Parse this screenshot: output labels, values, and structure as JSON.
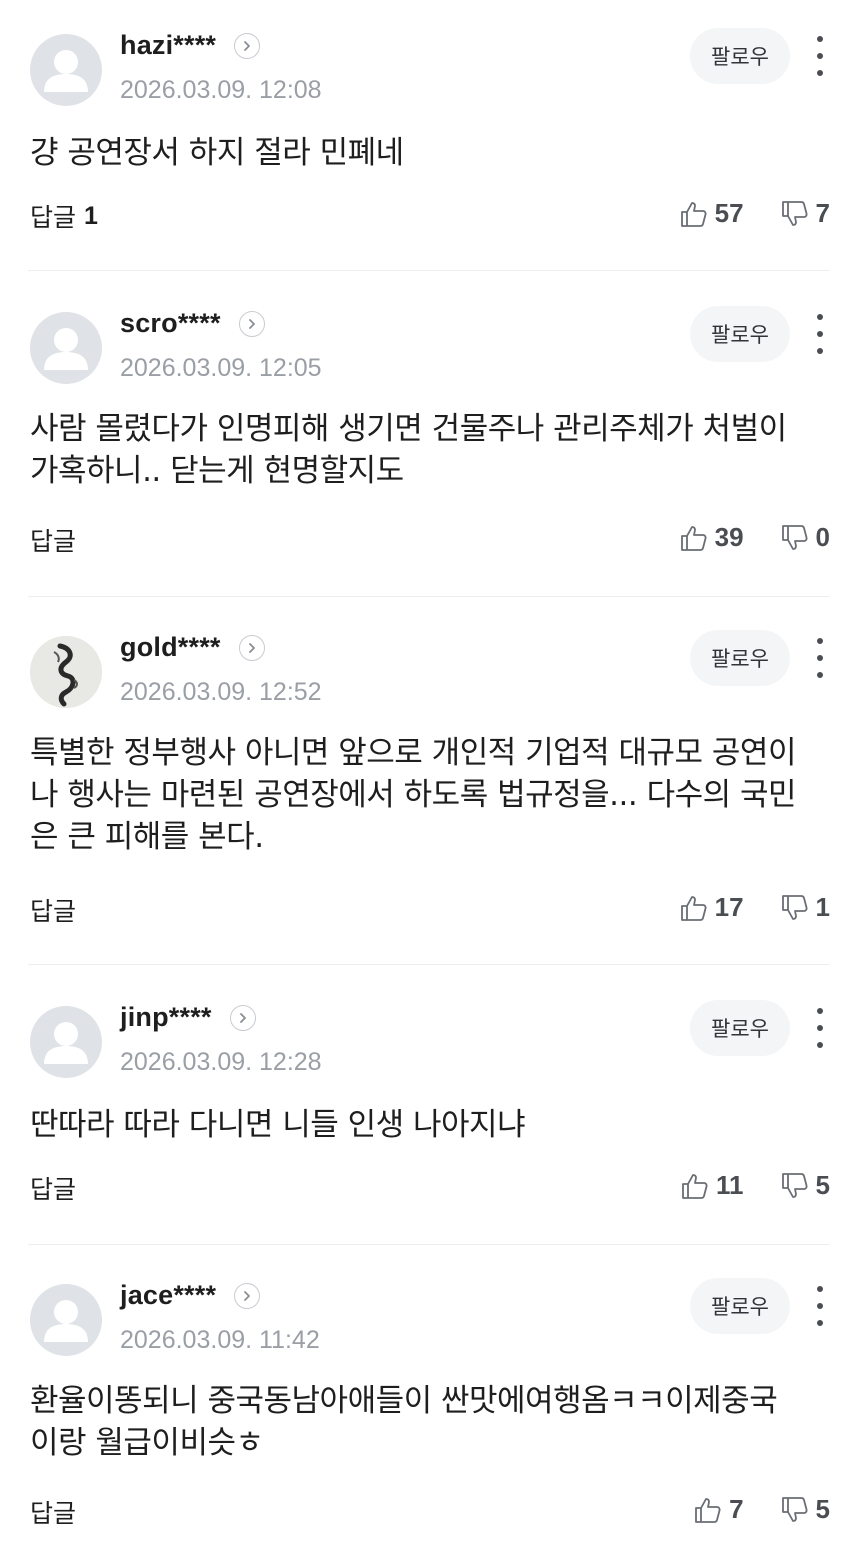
{
  "follow_label": "팔로우",
  "reply_label": "답글",
  "comments": [
    {
      "username": "hazi****",
      "timestamp": "2026.03.09. 12:08",
      "text": "걍 공연장서 하지 절라 민폐네",
      "reply_count": "1",
      "likes": "57",
      "dislikes": "7",
      "avatar": "default-avatar"
    },
    {
      "username": "scro****",
      "timestamp": "2026.03.09. 12:05",
      "text": "사람 몰렸다가 인명피해 생기면 건물주나 관리주체가 처벌이 가혹하니.. 닫는게 현명할지도",
      "reply_count": "",
      "likes": "39",
      "dislikes": "0",
      "avatar": "default-avatar"
    },
    {
      "username": "gold****",
      "timestamp": "2026.03.09. 12:52",
      "text": "특별한 정부행사 아니면 앞으로 개인적 기업적 대규모 공연이나 행사는 마련된 공연장에서 하도록 법규정을... 다수의 국민은 큰 피해를 본다.",
      "reply_count": "",
      "likes": "17",
      "dislikes": "1",
      "avatar": "custom-photo-avatar"
    },
    {
      "username": "jinp****",
      "timestamp": "2026.03.09. 12:28",
      "text": "딴따라 따라 다니면 니들 인생 나아지냐",
      "reply_count": "",
      "likes": "11",
      "dislikes": "5",
      "avatar": "default-avatar"
    },
    {
      "username": "jace****",
      "timestamp": "2026.03.09. 11:42",
      "text": "환율이똥되니 중국동남아애들이 싼맛에여행옴ㅋㅋ이제중국이랑 월급이비슷ㅎ",
      "reply_count": "",
      "likes": "7",
      "dislikes": "5",
      "avatar": "default-avatar"
    }
  ],
  "colors": {
    "text": "#1e1e1e",
    "meta": "#9a9ea5",
    "follow_bg": "#f4f5f7",
    "divider": "#eceef1",
    "avatar_bg": "#dfe2e6"
  }
}
